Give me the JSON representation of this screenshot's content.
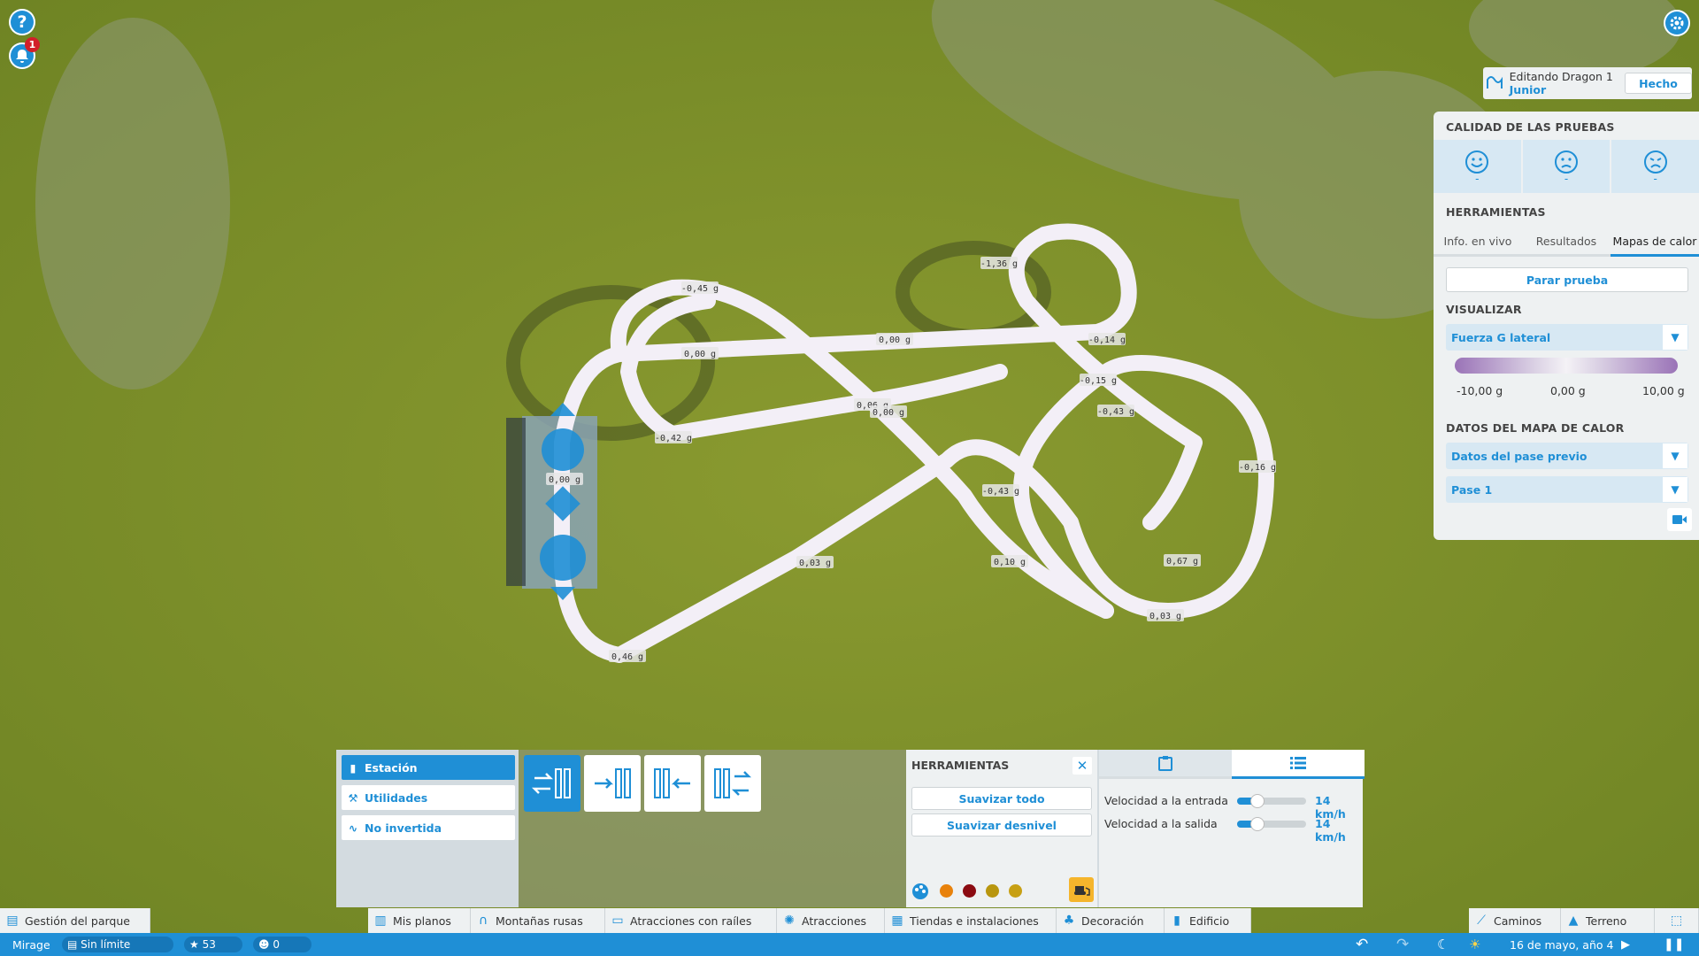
{
  "top_left": {
    "help_icon": "?",
    "notification_count": "1"
  },
  "edit_bar": {
    "editing_label": "Editando Dragon 1",
    "ride_name": "Junior",
    "done_label": "Hecho"
  },
  "right_panel": {
    "quality_title": "CALIDAD DE LAS PRUEBAS",
    "faces": [
      {
        "icon": "happy-face-icon",
        "value": "-"
      },
      {
        "icon": "neutral-face-icon",
        "value": "-"
      },
      {
        "icon": "sad-face-icon",
        "value": "-"
      }
    ],
    "tools_title": "HERRAMIENTAS",
    "tabs": [
      "Info. en vivo",
      "Resultados",
      "Mapas de calor"
    ],
    "active_tab": "Mapas de calor",
    "stop_test": "Parar prueba",
    "visualize_title": "VISUALIZAR",
    "visualize_value": "Fuerza G lateral",
    "scale": {
      "min": "-10,00 g",
      "mid": "0,00 g",
      "max": "10,00 g"
    },
    "heatmap_title": "DATOS DEL MAPA DE CALOR",
    "heatmap_source": "Datos del pase previo",
    "heatmap_pass": "Pase 1"
  },
  "g_labels": [
    "-1,36 g",
    "-0,45 g",
    "0,00 g",
    "0,00 g",
    "-0,14 g",
    "-0,15 g",
    "0,06 g",
    "0,00 g",
    "-0,43 g",
    "-0,16 g",
    "0,00 g",
    "-0,42 g",
    "-0,43 g",
    "0,03 g",
    "0,10 g",
    "0,67 g",
    "0,03 g",
    "0,46 g"
  ],
  "build_panel": {
    "categories": [
      {
        "label": "Estación",
        "selected": true
      },
      {
        "label": "Utilidades",
        "selected": false
      },
      {
        "label": "No invertida",
        "selected": false
      }
    ],
    "pieces": [
      "station-bidirectional",
      "station-forward",
      "station-backward",
      "station-switch"
    ],
    "tools": {
      "title": "HERRAMIENTAS",
      "smooth_all": "Suavizar todo",
      "smooth_slope": "Suavizar desnivel"
    },
    "swatches": [
      "#e8820c",
      "#8b0b12",
      "#b8960f",
      "#c7a014"
    ],
    "speed": {
      "entry_label": "Velocidad a la entrada",
      "entry_value": "14 km/h",
      "entry_level": 0.3,
      "exit_label": "Velocidad a la salida",
      "exit_value": "14 km/h",
      "exit_level": 0.3
    }
  },
  "toolbar": {
    "park_management": "Gestión del parque",
    "items": [
      "Mis planos",
      "Montañas rusas",
      "Atracciones con raíles",
      "Atracciones",
      "Tiendas e instalaciones",
      "Decoración",
      "Edificio"
    ],
    "paths": "Caminos",
    "terrain": "Terreno"
  },
  "status_bar": {
    "park_name": "Mirage",
    "money": "Sin límite",
    "rating": "53",
    "guests": "0",
    "date": "16 de mayo, año 4"
  }
}
